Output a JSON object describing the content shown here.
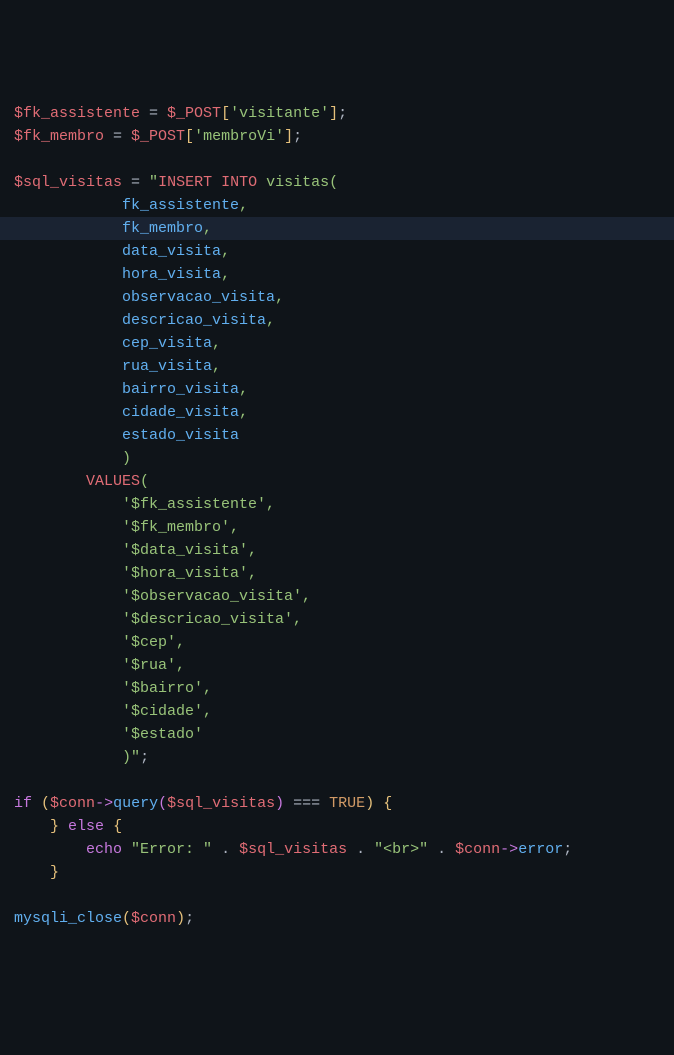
{
  "code": {
    "l1": {
      "v1": "$fk_assistente",
      "eq": " = ",
      "v2": "$_POST",
      "b1": "[",
      "s": "'visitante'",
      "b2": "]",
      "sc": ";"
    },
    "l2": {
      "v1": "$fk_membro",
      "eq": " = ",
      "v2": "$_POST",
      "b1": "[",
      "s": "'membroVi'",
      "b2": "]",
      "sc": ";"
    },
    "l4": {
      "v": "$sql_visitas",
      "eq": " = ",
      "q": "\"",
      "kw1": "INSERT",
      "sp": " ",
      "kw2": "INTO",
      "t": " visitas",
      "p": "("
    },
    "l5": {
      "t": "fk_assistente",
      "c": ","
    },
    "l6": {
      "t": "fk_membro",
      "c": ","
    },
    "l7": {
      "t": "data_visita",
      "c": ","
    },
    "l8": {
      "t": "hora_visita",
      "c": ","
    },
    "l9": {
      "t": "observacao_visita",
      "c": ","
    },
    "l10": {
      "t": "descricao_visita",
      "c": ","
    },
    "l11": {
      "t": "cep_visita",
      "c": ","
    },
    "l12": {
      "t": "rua_visita",
      "c": ","
    },
    "l13": {
      "t": "bairro_visita",
      "c": ","
    },
    "l14": {
      "t": "cidade_visita",
      "c": ","
    },
    "l15": {
      "t": "estado_visita"
    },
    "l16": {
      "t": ")"
    },
    "l17": {
      "kw": "VALUES",
      "p": "("
    },
    "l18": {
      "t": "'$fk_assistente',"
    },
    "l19": {
      "t": "'$fk_membro',"
    },
    "l20": {
      "t": "'$data_visita',"
    },
    "l21": {
      "t": "'$hora_visita',"
    },
    "l22": {
      "t": "'$observacao_visita',"
    },
    "l23": {
      "t": "'$descricao_visita',"
    },
    "l24": {
      "t": "'$cep',"
    },
    "l25": {
      "t": "'$rua',"
    },
    "l26": {
      "t": "'$bairro',"
    },
    "l27": {
      "t": "'$cidade',"
    },
    "l28": {
      "t": "'$estado'"
    },
    "l29": {
      "t": ")",
      "q": "\"",
      "sc": ";"
    },
    "l31": {
      "kw": "if",
      "sp": " ",
      "p1": "(",
      "v": "$conn",
      "ar": "->",
      "fn": "query",
      "p2": "(",
      "v2": "$sql_visitas",
      "p3": ")",
      "eq": " === ",
      "bo": "TRUE",
      "p4": ")",
      "sp2": " ",
      "b": "{"
    },
    "l32": {
      "b": "}",
      "sp": " ",
      "kw": "else",
      "sp2": " ",
      "b2": "{"
    },
    "l33": {
      "kw": "echo",
      "sp": " ",
      "s1": "\"Error: \"",
      "d1": " . ",
      "v1": "$sql_visitas",
      "d2": " . ",
      "s2": "\"<br>\"",
      "d3": " . ",
      "v2": "$conn",
      "ar": "->",
      "p": "error",
      "sc": ";"
    },
    "l34": {
      "b": "}"
    },
    "l36": {
      "fn": "mysqli_close",
      "p1": "(",
      "v": "$conn",
      "p2": ")",
      "sc": ";"
    }
  }
}
